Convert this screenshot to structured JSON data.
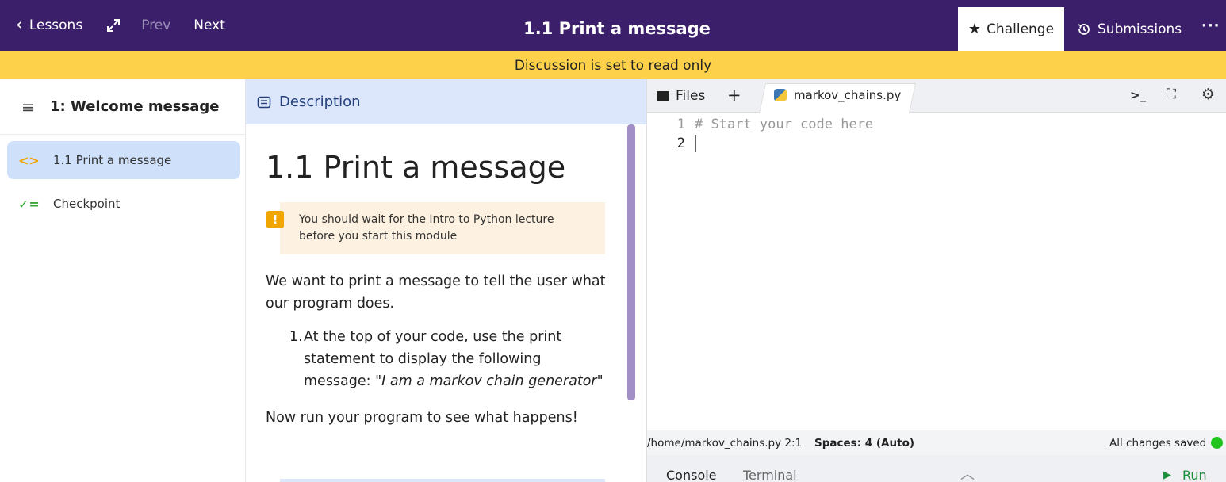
{
  "topbar": {
    "lessons_label": "Lessons",
    "prev_label": "Prev",
    "next_label": "Next",
    "title": "1.1 Print a message",
    "challenge_label": "Challenge",
    "submissions_label": "Submissions",
    "more_label": "···"
  },
  "banner": {
    "text": "Discussion is set to read only"
  },
  "sidebar": {
    "title": "1: Welcome message",
    "items": [
      {
        "label": "1.1 Print a message",
        "icon": "code-icon",
        "active": true
      },
      {
        "label": "Checkpoint",
        "icon": "checklist-icon",
        "active": false
      }
    ]
  },
  "description": {
    "tab_label": "Description",
    "heading": "1.1 Print a message",
    "callout": "You should wait for the Intro to Python lecture before you start this module",
    "paragraph": "We want to print a message to tell the user what our program does.",
    "list_number": "1.",
    "list_text": "At the top of your code, use the print statement to display the following message:",
    "list_quote": "\"I am a markov chain generator\"",
    "paragraph2": "Now run your program to see what happens!"
  },
  "editor": {
    "files_label": "Files",
    "plus_label": "+",
    "file_tab": "markov_chains.py",
    "lines": [
      {
        "num": "1",
        "text": "# Start your code here"
      },
      {
        "num": "2",
        "text": ""
      }
    ],
    "status": {
      "path": "/home/markov_chains.py  2:1",
      "spaces": "Spaces: 4 (Auto)",
      "saved": "All changes saved",
      "saved_color": "#22c41e"
    },
    "bottom": {
      "console_label": "Console",
      "terminal_label": "Terminal",
      "run_label": "Run"
    }
  },
  "colors": {
    "topbar": "#3c1f6a",
    "banner": "#fdd14a",
    "active_item": "#cfe0fb",
    "description_header": "#dde7fb",
    "run": "#1a8f3a"
  }
}
